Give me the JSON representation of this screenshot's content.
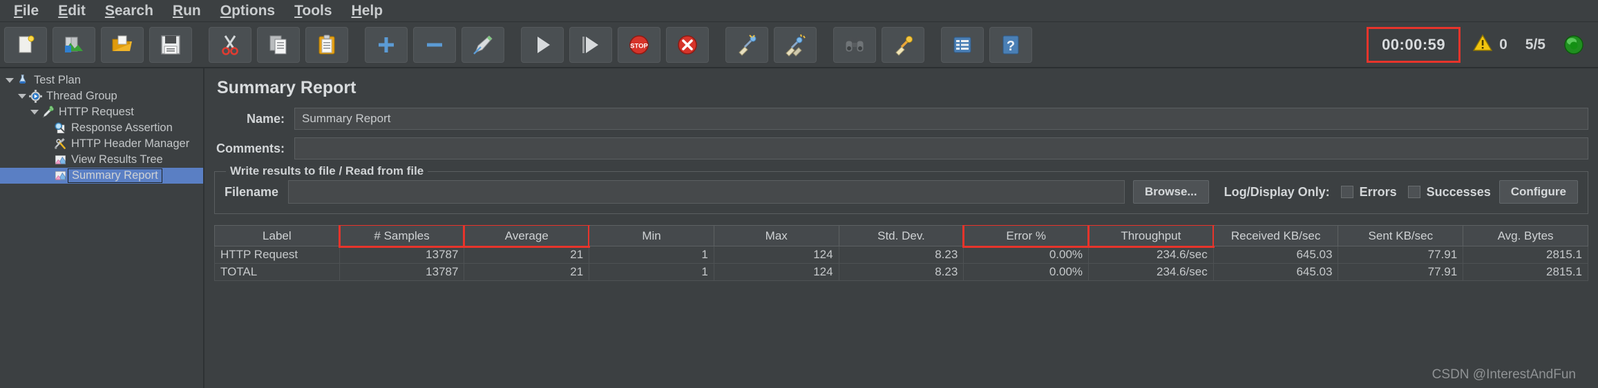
{
  "menu": {
    "items": [
      {
        "label": "File",
        "mnemonic": "F"
      },
      {
        "label": "Edit",
        "mnemonic": "E"
      },
      {
        "label": "Search",
        "mnemonic": "S"
      },
      {
        "label": "Run",
        "mnemonic": "R"
      },
      {
        "label": "Options",
        "mnemonic": "O"
      },
      {
        "label": "Tools",
        "mnemonic": "T"
      },
      {
        "label": "Help",
        "mnemonic": "H"
      }
    ]
  },
  "toolbar": {
    "buttons": [
      {
        "icon": "new-file-icon",
        "tooltip": "New"
      },
      {
        "icon": "templates-icon",
        "tooltip": "Templates"
      },
      {
        "icon": "open-folder-icon",
        "tooltip": "Open"
      },
      {
        "icon": "save-icon",
        "tooltip": "Save Test Plan"
      },
      {
        "icon": "cut-scissors-icon",
        "tooltip": "Cut"
      },
      {
        "icon": "copy-icon",
        "tooltip": "Copy"
      },
      {
        "icon": "paste-clipboard-icon",
        "tooltip": "Paste"
      },
      {
        "icon": "expand-plus-icon",
        "tooltip": "Expand All"
      },
      {
        "icon": "collapse-minus-icon",
        "tooltip": "Collapse All"
      },
      {
        "icon": "toggle-pencil-icon",
        "tooltip": "Toggle"
      },
      {
        "icon": "start-play-icon",
        "tooltip": "Start"
      },
      {
        "icon": "start-no-pause-icon",
        "tooltip": "Start no pauses"
      },
      {
        "icon": "stop-icon",
        "tooltip": "Stop"
      },
      {
        "icon": "shutdown-icon",
        "tooltip": "Shutdown"
      },
      {
        "icon": "clear-broom-icon",
        "tooltip": "Clear"
      },
      {
        "icon": "clear-all-broom-icon",
        "tooltip": "Clear All"
      },
      {
        "icon": "search-binoculars-icon",
        "tooltip": "Search"
      },
      {
        "icon": "reset-search-icon",
        "tooltip": "Reset Search"
      },
      {
        "icon": "function-helper-icon",
        "tooltip": "Function Helper Dialog"
      },
      {
        "icon": "help-question-icon",
        "tooltip": "Help"
      }
    ],
    "timer": "00:00:59",
    "warning_count": "0",
    "thread_count": "5/5",
    "timer_highlight_color": "#e8342b",
    "run_indicator_color": "#2bab2b"
  },
  "tree": {
    "nodes": [
      {
        "label": "Test Plan",
        "icon": "test-plan-flask-icon",
        "depth": 0,
        "expanded": true,
        "selected": false
      },
      {
        "label": "Thread Group",
        "icon": "thread-group-gear-icon",
        "depth": 1,
        "expanded": true,
        "selected": false
      },
      {
        "label": "HTTP Request",
        "icon": "http-request-pipette-icon",
        "depth": 2,
        "expanded": true,
        "selected": false
      },
      {
        "label": "Response Assertion",
        "icon": "response-assertion-magnifier-icon",
        "depth": 3,
        "expanded": false,
        "selected": false
      },
      {
        "label": "HTTP Header Manager",
        "icon": "header-manager-tools-icon",
        "depth": 3,
        "expanded": false,
        "selected": false
      },
      {
        "label": "View Results Tree",
        "icon": "results-chart-icon",
        "depth": 3,
        "expanded": false,
        "selected": false
      },
      {
        "label": "Summary Report",
        "icon": "results-chart-icon",
        "depth": 3,
        "expanded": false,
        "selected": true
      }
    ]
  },
  "panel": {
    "title": "Summary Report",
    "name_label": "Name:",
    "name_value": "Summary Report",
    "name_placeholder": "",
    "comments_label": "Comments:",
    "comments_value": "",
    "comments_placeholder": "",
    "group_title": "Write results to file / Read from file",
    "filename_label": "Filename",
    "filename_value": "",
    "filename_placeholder": "",
    "browse_label": "Browse...",
    "logdisplay_label": "Log/Display Only:",
    "errors_label": "Errors",
    "errors_checked": false,
    "successes_label": "Successes",
    "successes_checked": false,
    "configure_label": "Configure"
  },
  "table": {
    "columns": [
      {
        "label": "Label",
        "highlighted": false,
        "align": "left"
      },
      {
        "label": "# Samples",
        "highlighted": true,
        "align": "right"
      },
      {
        "label": "Average",
        "highlighted": true,
        "align": "right"
      },
      {
        "label": "Min",
        "highlighted": false,
        "align": "right"
      },
      {
        "label": "Max",
        "highlighted": false,
        "align": "right"
      },
      {
        "label": "Std. Dev.",
        "highlighted": false,
        "align": "right"
      },
      {
        "label": "Error %",
        "highlighted": true,
        "align": "right"
      },
      {
        "label": "Throughput",
        "highlighted": true,
        "align": "right"
      },
      {
        "label": "Received KB/sec",
        "highlighted": false,
        "align": "right"
      },
      {
        "label": "Sent KB/sec",
        "highlighted": false,
        "align": "right"
      },
      {
        "label": "Avg. Bytes",
        "highlighted": false,
        "align": "right"
      }
    ],
    "rows": [
      [
        "HTTP Request",
        "13787",
        "21",
        "1",
        "124",
        "8.23",
        "0.00%",
        "234.6/sec",
        "645.03",
        "77.91",
        "2815.1"
      ],
      [
        "TOTAL",
        "13787",
        "21",
        "1",
        "124",
        "8.23",
        "0.00%",
        "234.6/sec",
        "645.03",
        "77.91",
        "2815.1"
      ]
    ]
  },
  "watermark": {
    "text": "CSDN @InterestAndFun"
  }
}
